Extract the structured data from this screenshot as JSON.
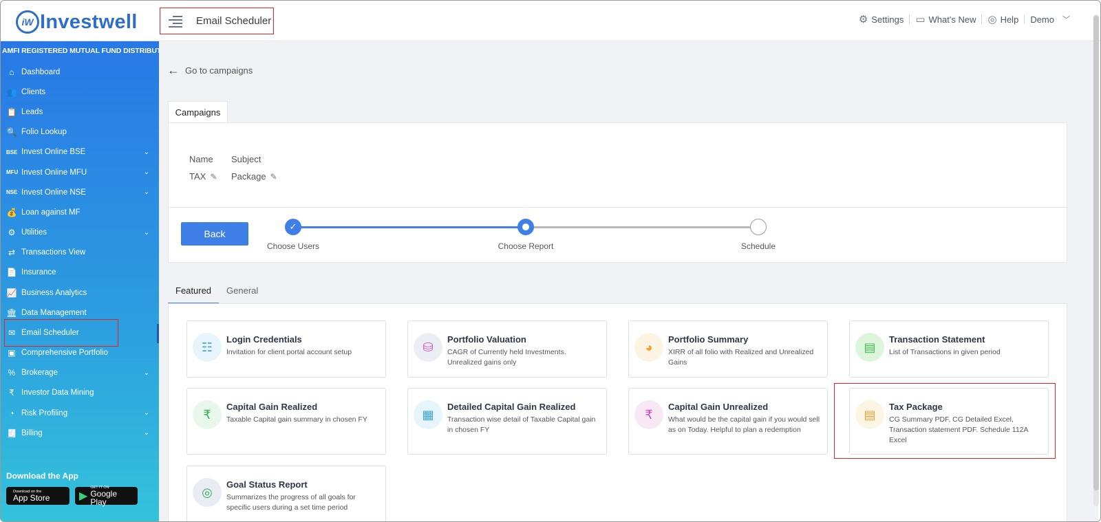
{
  "header": {
    "logo_mark": "iW",
    "logo_text": "Investwell",
    "page_title": "Email Scheduler",
    "settings": "Settings",
    "whats_new": "What's New",
    "help": "Help",
    "user": "Demo"
  },
  "sidebar": {
    "tagline": "AMFI REGISTERED MUTUAL FUND DISTRIBUTOR",
    "items": [
      {
        "label": "Dashboard",
        "icon": "home-icon",
        "glyph": "⌂"
      },
      {
        "label": "Clients",
        "icon": "users-icon",
        "glyph": "👥"
      },
      {
        "label": "Leads",
        "icon": "leads-icon",
        "glyph": "📋"
      },
      {
        "label": "Folio Lookup",
        "icon": "folio-icon",
        "glyph": "🔍"
      },
      {
        "label": "Invest Online BSE",
        "icon": "bse-icon",
        "prefix": "BSE",
        "caret": true
      },
      {
        "label": "Invest Online MFU",
        "icon": "mfu-icon",
        "prefix": "MFU",
        "caret": true
      },
      {
        "label": "Invest Online NSE",
        "icon": "nse-icon",
        "prefix": "NSE",
        "caret": true
      },
      {
        "label": "Loan against MF",
        "icon": "loan-icon",
        "glyph": "💰"
      },
      {
        "label": "Utilities",
        "icon": "utilities-icon",
        "glyph": "⚙",
        "caret": true
      },
      {
        "label": "Transactions View",
        "icon": "transactions-icon",
        "glyph": "⇄"
      },
      {
        "label": "Insurance",
        "icon": "insurance-icon",
        "glyph": "📄"
      },
      {
        "label": "Business Analytics",
        "icon": "analytics-icon",
        "glyph": "📈"
      },
      {
        "label": "Data Management",
        "icon": "data-icon",
        "glyph": "🏛"
      },
      {
        "label": "Email Scheduler",
        "icon": "email-icon",
        "glyph": "✉",
        "active": true
      },
      {
        "label": "Comprehensive Portfolio",
        "icon": "portfolio-icon",
        "glyph": "▣"
      },
      {
        "label": "Brokerage",
        "icon": "brokerage-icon",
        "glyph": "%",
        "caret": true
      },
      {
        "label": "Investor Data Mining",
        "icon": "mining-icon",
        "glyph": "₹"
      },
      {
        "label": "Risk Profiling",
        "icon": "risk-icon",
        "glyph": "◔",
        "caret": true
      },
      {
        "label": "Billing",
        "icon": "billing-icon",
        "glyph": "🧾",
        "caret": true
      }
    ],
    "download_label": "Download the App",
    "app_store_small": "Download on the",
    "app_store_big": "App Store",
    "google_play_small": "GET IT ON",
    "google_play_big": "Google Play"
  },
  "main": {
    "go_to_campaigns": "Go to campaigns",
    "campaigns_tab": "Campaigns",
    "name_label": "Name",
    "name_value": "TAX",
    "subject_label": "Subject",
    "subject_value": "Package",
    "back_button": "Back",
    "steps": [
      "Choose Users",
      "Choose Report",
      "Schedule"
    ],
    "subtabs": [
      "Featured",
      "General"
    ],
    "reports": [
      {
        "title": "Login Credentials",
        "desc": "Invitation for client portal account setup",
        "icon": "login-credentials-icon",
        "glyph": "☷",
        "bg": "#e8f4fb",
        "fg": "#4aa3d8"
      },
      {
        "title": "Portfolio Valuation",
        "desc": "CAGR of Currently held Investments. Unrealized gains only",
        "icon": "portfolio-valuation-icon",
        "glyph": "⛁",
        "bg": "#eceef5",
        "fg": "#d04fc8"
      },
      {
        "title": "Portfolio Summary",
        "desc": "XIRR of all folio with Realized and Unrealized Gains",
        "icon": "portfolio-summary-icon",
        "glyph": "◕",
        "bg": "#fdf3e3",
        "fg": "#f0a330"
      },
      {
        "title": "Transaction Statement",
        "desc": "List of Transactions in given period",
        "icon": "transaction-statement-icon",
        "glyph": "▤",
        "bg": "#dcf5dc",
        "fg": "#3fbf4f"
      },
      {
        "title": "Capital Gain Realized",
        "desc": "Taxable Capital gain summary in chosen FY",
        "icon": "capital-gain-realized-icon",
        "glyph": "₹",
        "bg": "#e7f7ec",
        "fg": "#3bb063"
      },
      {
        "title": "Detailed Capital Gain Realized",
        "desc": "Transaction wise detail of Taxable Capital gain in chosen FY",
        "icon": "detailed-capital-gain-icon",
        "glyph": "▦",
        "bg": "#e6f4fb",
        "fg": "#3aa4d6"
      },
      {
        "title": "Capital Gain Unrealized",
        "desc": "What would be the capital gain if you would sell as on Today. Helpful to plan a redemption",
        "icon": "capital-gain-unrealized-icon",
        "glyph": "₹",
        "bg": "#f8e8f6",
        "fg": "#cf4ec3"
      },
      {
        "title": "Tax Package",
        "desc": "CG Summary PDF, CG Detailed Excel, Transaction statement PDF. Schedule 112A Excel",
        "icon": "tax-package-icon",
        "glyph": "▤",
        "bg": "#fdf5e4",
        "fg": "#f0a330"
      },
      {
        "title": "Goal Status Report",
        "desc": "Summarizes the progress of all goals for specific users during a set time period",
        "icon": "goal-status-icon",
        "glyph": "◎",
        "bg": "#e9ecf2",
        "fg": "#3bb063"
      }
    ]
  }
}
